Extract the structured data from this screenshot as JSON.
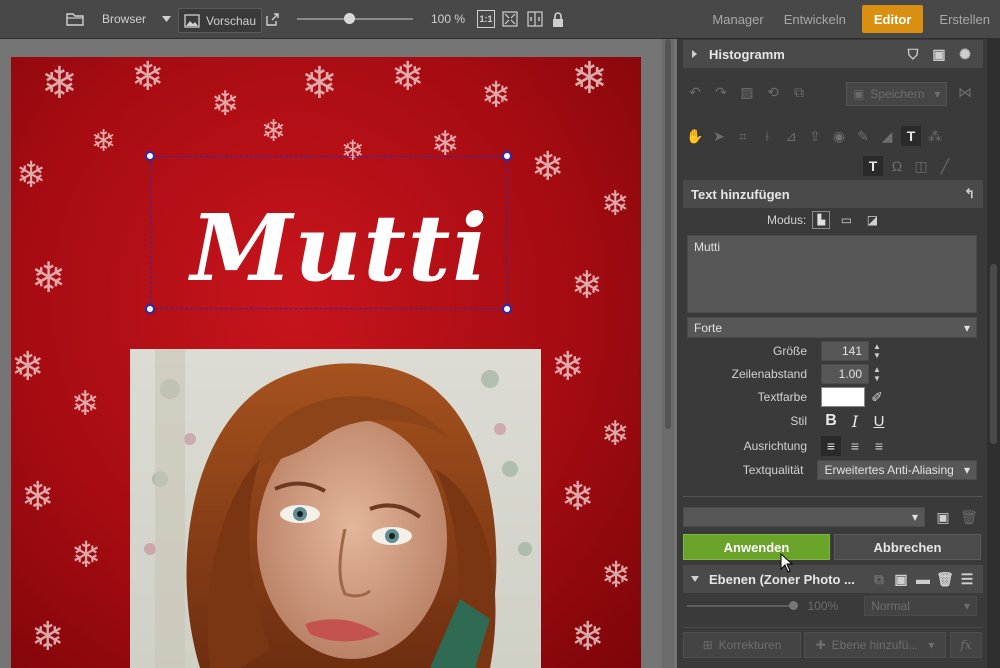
{
  "topbar": {
    "browser_label": "Browser",
    "preview_label": "Vorschau",
    "zoom_value": "100 %",
    "zoom_slider_fraction": 0.45,
    "one_to_one_label": "1:1",
    "modules": [
      {
        "label": "Manager",
        "active": false
      },
      {
        "label": "Entwickeln",
        "active": false
      },
      {
        "label": "Editor",
        "active": true
      },
      {
        "label": "Erstellen",
        "active": false
      }
    ]
  },
  "canvas": {
    "overlay_text": "Mutti"
  },
  "panel": {
    "histogram_title": "Histogramm",
    "save_label": "Speichern",
    "text_tool_title": "Text hinzufügen",
    "mode_label": "Modus:",
    "text_content": "Mutti",
    "font_name": "Forte",
    "size_label": "Größe",
    "size_value": "141",
    "line_spacing_label": "Zeilenabstand",
    "line_spacing_value": "1.00",
    "text_color_label": "Textfarbe",
    "text_color": "#ffffff",
    "style_label": "Stil",
    "bold_glyph": "B",
    "italic_glyph": "I",
    "underline_glyph": "U",
    "alignment_label": "Ausrichtung",
    "quality_label": "Textqualität",
    "quality_value": "Erweitertes Anti-Aliasing",
    "apply_label": "Anwenden",
    "cancel_label": "Abbrechen",
    "layers_title": "Ebenen (Zoner Photo ...",
    "opacity_value": "100%",
    "blend_mode": "Normal",
    "corrections_label": "Korrekturen",
    "add_layer_label": "Ebene hinzufü...",
    "fx_label": "fx"
  },
  "colors": {
    "accent": "#d99011",
    "apply_button": "#6aa42a",
    "poster_red": "#b30f16"
  }
}
